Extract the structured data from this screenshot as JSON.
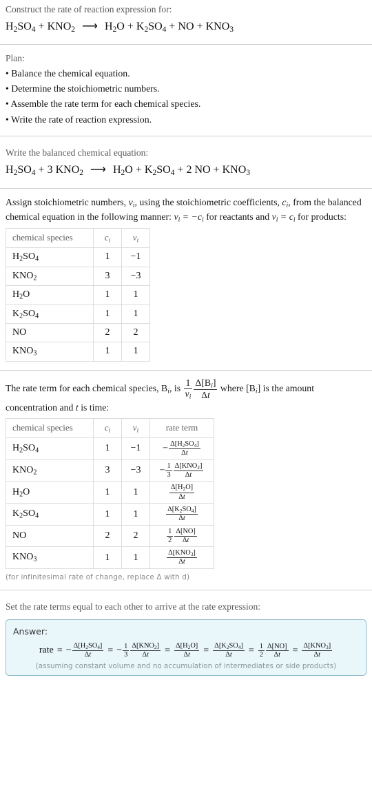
{
  "header": {
    "prompt": "Construct the rate of reaction expression for:",
    "equation": {
      "reactants": [
        "H2SO4",
        "KNO2"
      ],
      "arrow": "⟶",
      "products": [
        "H2O",
        "K2SO4",
        "NO",
        "KNO3"
      ],
      "display": "H_2SO_4 + KNO_2 ⟶ H_2O + K_2SO_4 + NO + KNO_3"
    }
  },
  "plan": {
    "heading": "Plan:",
    "items": [
      "• Balance the chemical equation.",
      "• Determine the stoichiometric numbers.",
      "• Assemble the rate term for each chemical species.",
      "• Write the rate of reaction expression."
    ]
  },
  "balanced": {
    "heading": "Write the balanced chemical equation:",
    "display": "H_2SO_4 + 3 KNO_2 ⟶ H_2O + K_2SO_4 + 2 NO + KNO_3",
    "reactant_coeffs": [
      "",
      "3"
    ],
    "product_coeffs": [
      "",
      "",
      "2",
      ""
    ]
  },
  "stoich_intro": {
    "text_part1": "Assign stoichiometric numbers, ",
    "nu_i": "ν",
    "text_part2": ", using the stoichiometric coefficients, ",
    "c_i": "c",
    "text_part3": ", from the balanced chemical equation in the following manner: ",
    "rule_reactants": "ν_i = −c_i for reactants",
    "rule_products": "and ν_i = c_i for products:"
  },
  "stoich_table": {
    "headers": [
      "chemical species",
      "c",
      "ν"
    ],
    "header_sub": "i",
    "rows": [
      {
        "species": "H2SO4",
        "c": "1",
        "nu": "−1"
      },
      {
        "species": "KNO2",
        "c": "3",
        "nu": "−3"
      },
      {
        "species": "H2O",
        "c": "1",
        "nu": "1"
      },
      {
        "species": "K2SO4",
        "c": "1",
        "nu": "1"
      },
      {
        "species": "NO",
        "c": "2",
        "nu": "2"
      },
      {
        "species": "KNO3",
        "c": "1",
        "nu": "1"
      }
    ]
  },
  "rate_intro": {
    "part1": "The rate term for each chemical species, B",
    "sub1": "i",
    "part2": ", is ",
    "frac_num": "1",
    "frac_den": "ν",
    "frac_den_sub": "i",
    "delta_num": "Δ[B",
    "delta_num_sub": "i",
    "delta_num_end": "]",
    "delta_den": "Δt",
    "part3": " where [B",
    "sub3": "i",
    "part4": "] is the amount concentration and ",
    "t_italic": "t",
    "part5": " is time:"
  },
  "rate_table": {
    "headers": [
      "chemical species",
      "c",
      "ν",
      "rate term"
    ],
    "header_sub": "i",
    "rows": [
      {
        "species": "H2SO4",
        "c": "1",
        "nu": "−1",
        "sign": "−",
        "coef_num": "",
        "coef_den": "",
        "num": "Δ[H2SO4]",
        "den": "Δt"
      },
      {
        "species": "KNO2",
        "c": "3",
        "nu": "−3",
        "sign": "−",
        "coef_num": "1",
        "coef_den": "3",
        "num": "Δ[KNO2]",
        "den": "Δt"
      },
      {
        "species": "H2O",
        "c": "1",
        "nu": "1",
        "sign": "",
        "coef_num": "",
        "coef_den": "",
        "num": "Δ[H2O]",
        "den": "Δt"
      },
      {
        "species": "K2SO4",
        "c": "1",
        "nu": "1",
        "sign": "",
        "coef_num": "",
        "coef_den": "",
        "num": "Δ[K2SO4]",
        "den": "Δt"
      },
      {
        "species": "NO",
        "c": "2",
        "nu": "2",
        "sign": "",
        "coef_num": "1",
        "coef_den": "2",
        "num": "Δ[NO]",
        "den": "Δt"
      },
      {
        "species": "KNO3",
        "c": "1",
        "nu": "1",
        "sign": "",
        "coef_num": "",
        "coef_den": "",
        "num": "Δ[KNO3]",
        "den": "Δt"
      }
    ],
    "footnote": "(for infinitesimal rate of change, replace Δ with d)"
  },
  "final": {
    "heading": "Set the rate terms equal to each other to arrive at the rate expression:",
    "answer_label": "Answer:",
    "rate_word": "rate",
    "terms": [
      {
        "sign": "−",
        "coef_num": "",
        "coef_den": "",
        "num": "Δ[H2SO4]",
        "den": "Δt"
      },
      {
        "sign": "−",
        "coef_num": "1",
        "coef_den": "3",
        "num": "Δ[KNO2]",
        "den": "Δt"
      },
      {
        "sign": "",
        "coef_num": "",
        "coef_den": "",
        "num": "Δ[H2O]",
        "den": "Δt"
      },
      {
        "sign": "",
        "coef_num": "",
        "coef_den": "",
        "num": "Δ[K2SO4]",
        "den": "Δt"
      },
      {
        "sign": "",
        "coef_num": "1",
        "coef_den": "2",
        "num": "Δ[NO]",
        "den": "Δt"
      },
      {
        "sign": "",
        "coef_num": "",
        "coef_den": "",
        "num": "Δ[KNO3]",
        "den": "Δt"
      }
    ],
    "equals": "=",
    "note": "(assuming constant volume and no accumulation of intermediates or side products)"
  },
  "colors": {
    "answer_bg": "#e9f7fb",
    "answer_border": "#8fb8c8",
    "rule": "#cfcfcf",
    "muted_text": "#58585c"
  }
}
